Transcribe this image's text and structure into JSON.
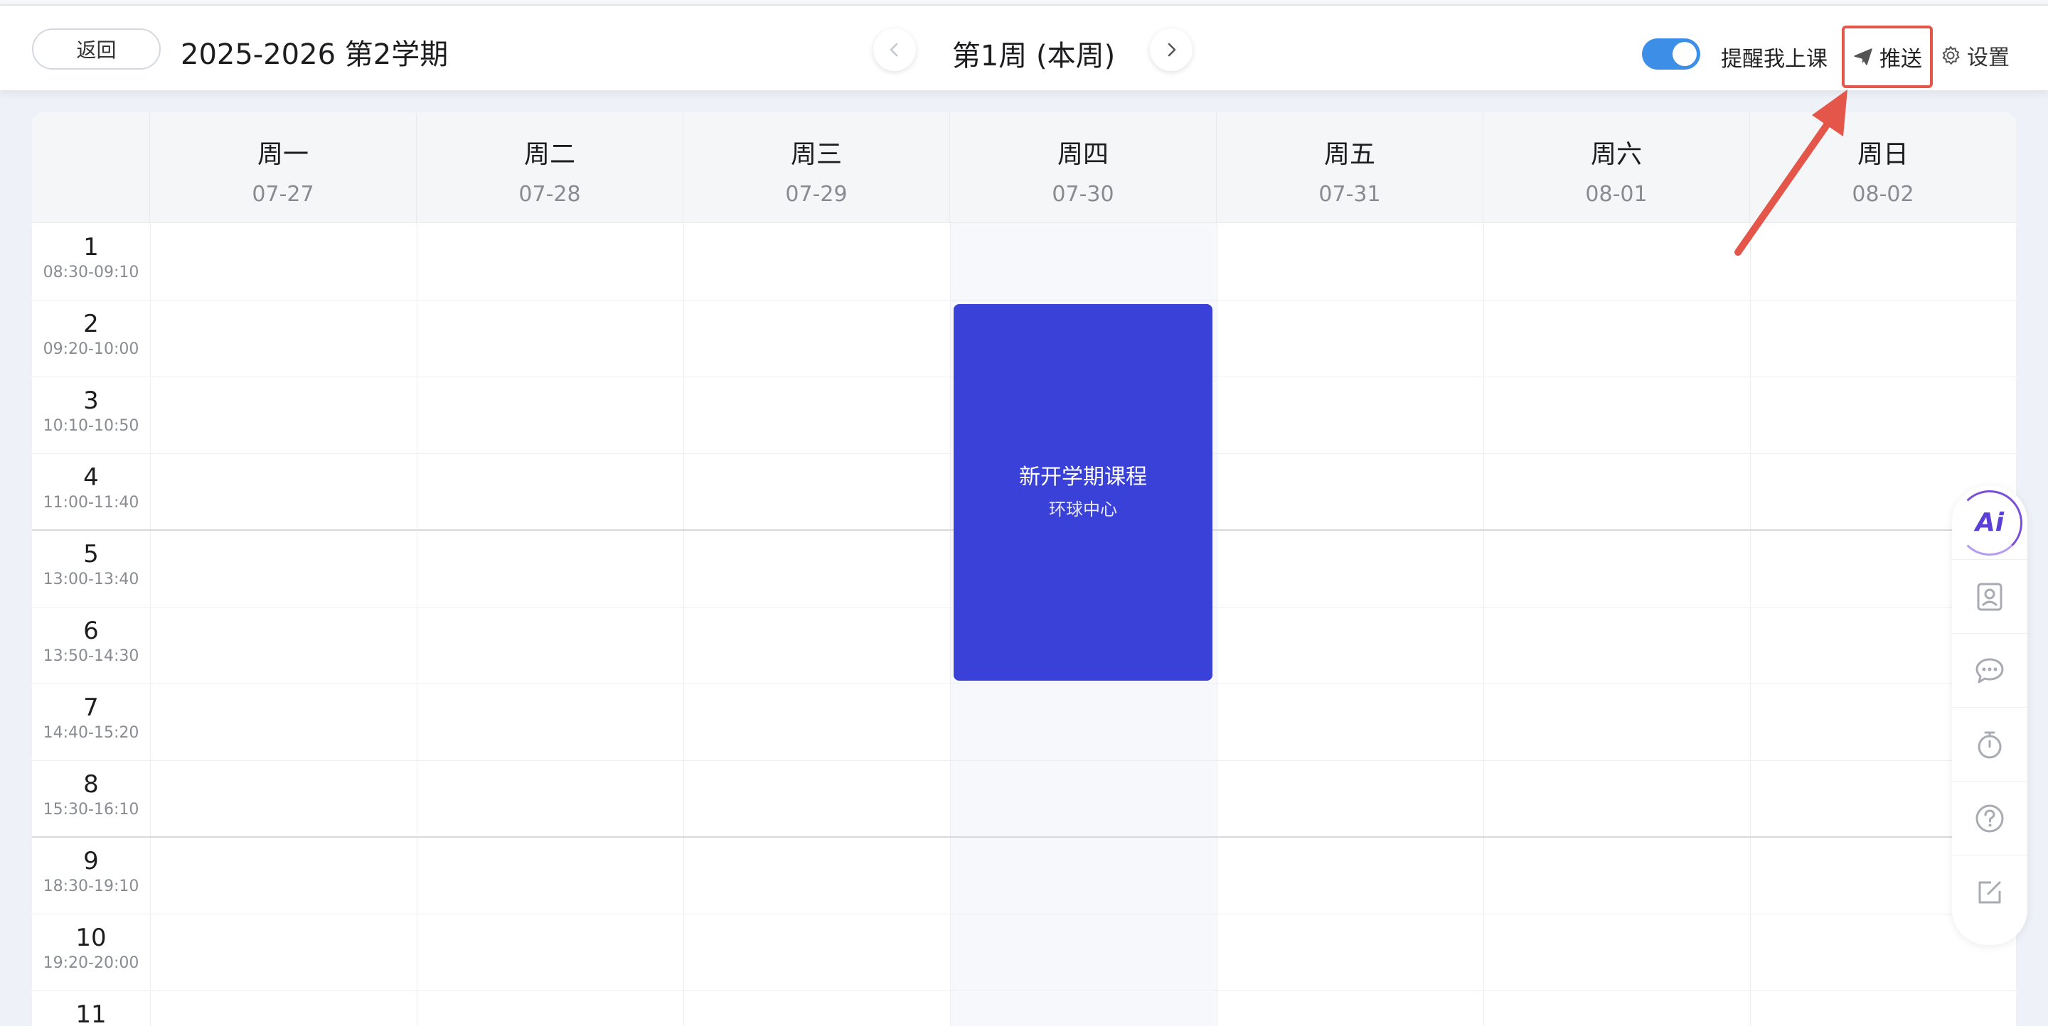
{
  "header": {
    "back_label": "返回",
    "term_title": "2025-2026 第2学期",
    "week_title": "第1周 (本周)",
    "remind_label": "提醒我上课",
    "remind_enabled": true,
    "push_label": "推送",
    "settings_label": "设置"
  },
  "days": [
    {
      "name": "周一",
      "date": "07-27"
    },
    {
      "name": "周二",
      "date": "07-28"
    },
    {
      "name": "周三",
      "date": "07-29"
    },
    {
      "name": "周四",
      "date": "07-30"
    },
    {
      "name": "周五",
      "date": "07-31"
    },
    {
      "name": "周六",
      "date": "08-01"
    },
    {
      "name": "周日",
      "date": "08-02"
    }
  ],
  "periods": [
    {
      "num": "1",
      "time": "08:30-09:10"
    },
    {
      "num": "2",
      "time": "09:20-10:00"
    },
    {
      "num": "3",
      "time": "10:10-10:50"
    },
    {
      "num": "4",
      "time": "11:00-11:40"
    },
    {
      "num": "5",
      "time": "13:00-13:40"
    },
    {
      "num": "6",
      "time": "13:50-14:30"
    },
    {
      "num": "7",
      "time": "14:40-15:20"
    },
    {
      "num": "8",
      "time": "15:30-16:10"
    },
    {
      "num": "9",
      "time": "18:30-19:10"
    },
    {
      "num": "10",
      "time": "19:20-20:00"
    },
    {
      "num": "11",
      "time": ""
    }
  ],
  "course": {
    "name": "新开学期课程",
    "location": "环球中心",
    "color": "#3a41d9"
  },
  "side_toolbar": {
    "items": [
      "ai-icon",
      "contact-card-icon",
      "chat-bubble-icon",
      "timer-icon",
      "help-icon",
      "edit-icon"
    ],
    "ai_label": "Ai"
  },
  "colors": {
    "accent": "#3d8ee6",
    "highlight_border": "#e4564a",
    "annotation_arrow": "#e4564a"
  }
}
